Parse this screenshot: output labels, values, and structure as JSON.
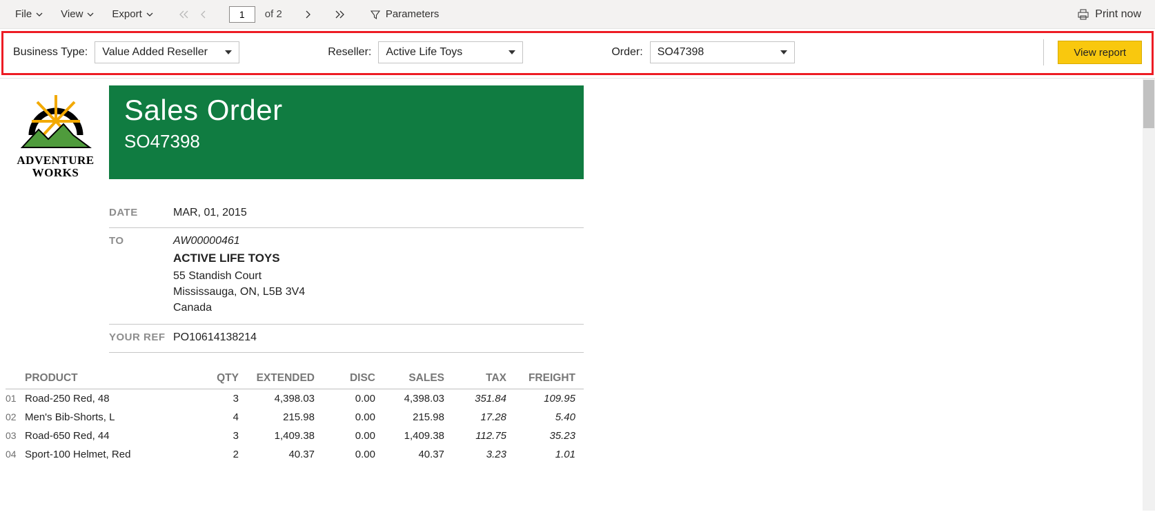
{
  "toolbar": {
    "file_label": "File",
    "view_label": "View",
    "export_label": "Export",
    "page_current": "1",
    "page_total": "of 2",
    "parameters_label": "Parameters",
    "print_label": "Print now"
  },
  "params": {
    "business_type": {
      "label": "Business Type:",
      "value": "Value Added Reseller"
    },
    "reseller": {
      "label": "Reseller:",
      "value": "Active Life Toys"
    },
    "order": {
      "label": "Order:",
      "value": "SO47398"
    },
    "view_report_label": "View report"
  },
  "logo": {
    "line1": "ADVENTURE",
    "line2": "WORKS"
  },
  "banner": {
    "title": "Sales Order",
    "order_no": "SO47398"
  },
  "info": {
    "date": {
      "label": "DATE",
      "value": "MAR, 01, 2015"
    },
    "to": {
      "label": "TO",
      "code": "AW00000461",
      "name": "ACTIVE LIFE TOYS",
      "street": "55 Standish Court",
      "city": "Mississauga, ON, L5B 3V4",
      "country": "Canada"
    },
    "ref": {
      "label": "YOUR REF",
      "value": "PO10614138214"
    }
  },
  "table": {
    "headers": {
      "product": "PRODUCT",
      "qty": "QTY",
      "extended": "EXTENDED",
      "disc": "DISC",
      "sales": "SALES",
      "tax": "TAX",
      "freight": "FREIGHT"
    },
    "rows": [
      {
        "idx": "01",
        "product": "Road-250 Red, 48",
        "qty": "3",
        "extended": "4,398.03",
        "disc": "0.00",
        "sales": "4,398.03",
        "tax": "351.84",
        "freight": "109.95"
      },
      {
        "idx": "02",
        "product": "Men's Bib-Shorts, L",
        "qty": "4",
        "extended": "215.98",
        "disc": "0.00",
        "sales": "215.98",
        "tax": "17.28",
        "freight": "5.40"
      },
      {
        "idx": "03",
        "product": "Road-650 Red, 44",
        "qty": "3",
        "extended": "1,409.38",
        "disc": "0.00",
        "sales": "1,409.38",
        "tax": "112.75",
        "freight": "35.23"
      },
      {
        "idx": "04",
        "product": "Sport-100 Helmet, Red",
        "qty": "2",
        "extended": "40.37",
        "disc": "0.00",
        "sales": "40.37",
        "tax": "3.23",
        "freight": "1.01"
      }
    ]
  }
}
